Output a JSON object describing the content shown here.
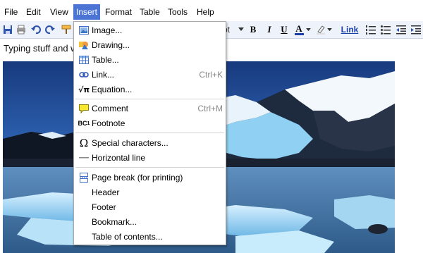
{
  "menubar": {
    "items": [
      "File",
      "Edit",
      "View",
      "Insert",
      "Format",
      "Table",
      "Tools",
      "Help"
    ],
    "active": "Insert"
  },
  "toolbar": {
    "font_size_fragment": "pt",
    "link_label": "Link",
    "bold": "B",
    "italic": "I",
    "underline": "U",
    "text_color": "A"
  },
  "document": {
    "text": "Typing stuff and w"
  },
  "insert_menu": {
    "items": [
      {
        "label": "Image...",
        "icon": "image-icon",
        "shortcut": ""
      },
      {
        "label": "Drawing...",
        "icon": "drawing-icon",
        "shortcut": ""
      },
      {
        "label": "Table...",
        "icon": "table-icon",
        "shortcut": ""
      },
      {
        "label": "Link...",
        "icon": "link-icon",
        "shortcut": "Ctrl+K"
      },
      {
        "label": "Equation...",
        "icon": "equation-icon",
        "shortcut": ""
      },
      {
        "label": "Comment",
        "icon": "comment-icon",
        "shortcut": "Ctrl+M"
      },
      {
        "label": "Footnote",
        "icon": "footnote-icon",
        "shortcut": ""
      },
      {
        "label": "Special characters...",
        "icon": "omega-icon",
        "shortcut": ""
      },
      {
        "label": "Horizontal line",
        "icon": "horizontal-line-icon",
        "shortcut": ""
      },
      {
        "label": "Page break (for printing)",
        "icon": "page-break-icon",
        "shortcut": ""
      },
      {
        "label": "Header",
        "icon": "",
        "shortcut": ""
      },
      {
        "label": "Footer",
        "icon": "",
        "shortcut": ""
      },
      {
        "label": "Bookmark...",
        "icon": "",
        "shortcut": ""
      },
      {
        "label": "Table of contents...",
        "icon": "",
        "shortcut": ""
      }
    ]
  },
  "colors": {
    "menu_highlight": "#4b74d5",
    "toolbar_bg": "#eef2fb",
    "link_blue": "#1a3fa8"
  }
}
